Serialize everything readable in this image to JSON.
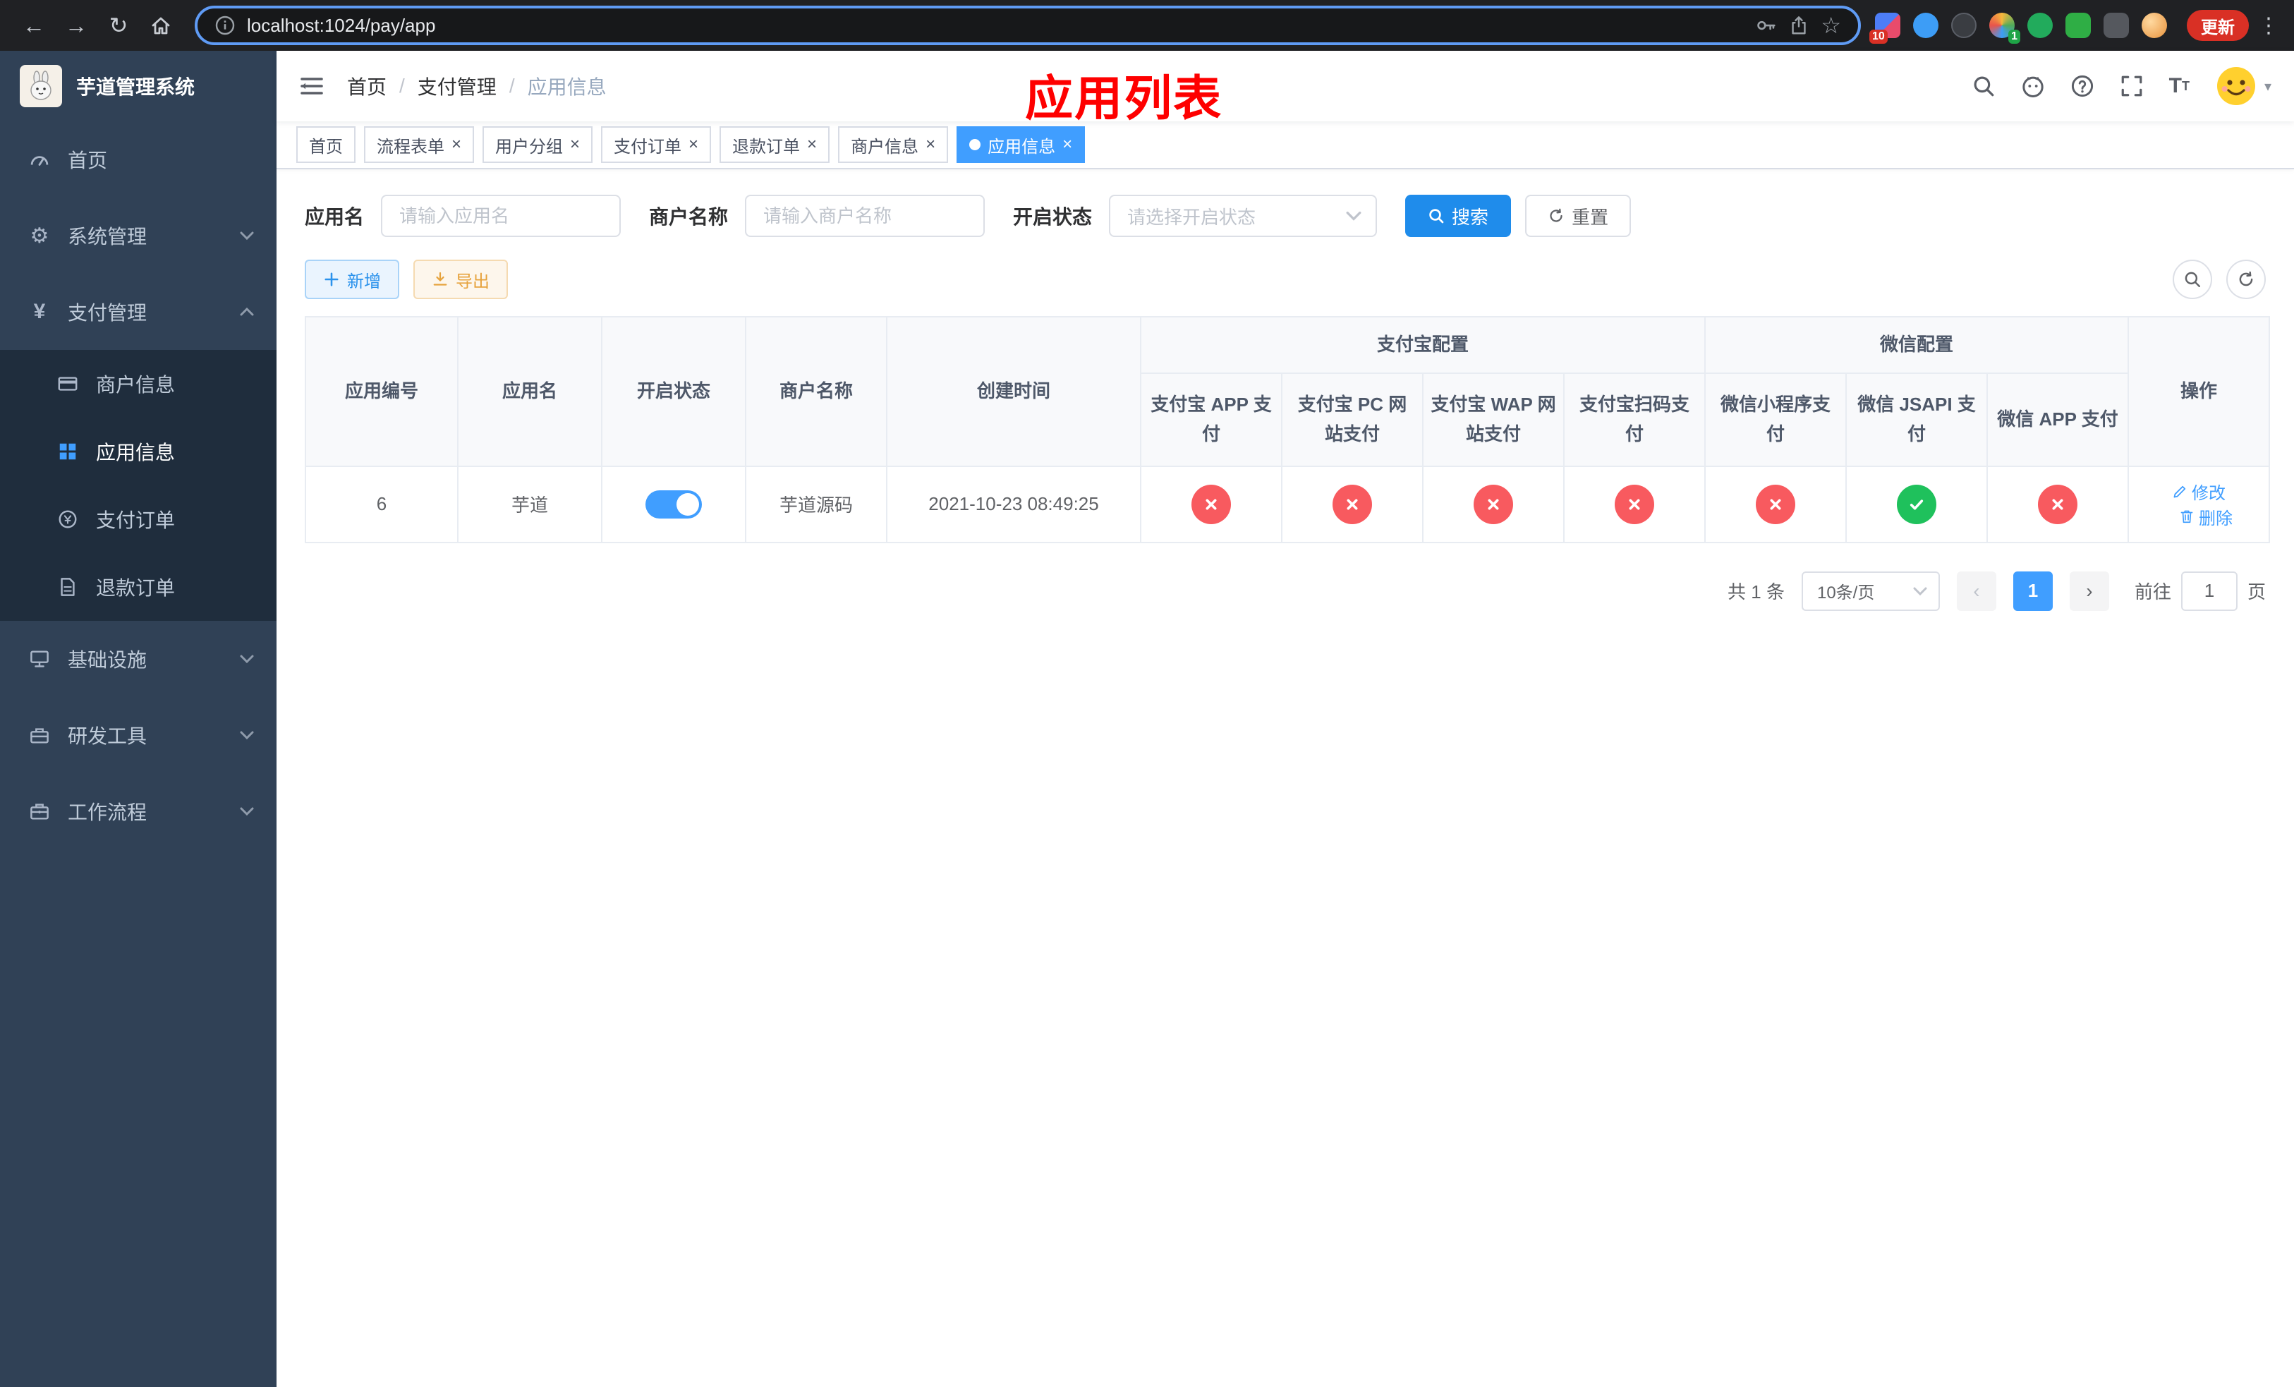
{
  "colors": {
    "primary": "#409eff",
    "success": "#1fc15c",
    "danger": "#f85a5f",
    "warning": "#e6a23c",
    "sidebar_bg": "#304156",
    "submenu_bg": "#1f2d3d",
    "annotation_red": "#fe0000"
  },
  "browser": {
    "url": "localhost:1024/pay/app",
    "update_label": "更新",
    "ext_badge_grid": "10",
    "ext_badge_translate": "1"
  },
  "sidebar": {
    "title": "芋道管理系统",
    "items": [
      {
        "label": "首页"
      },
      {
        "label": "系统管理"
      },
      {
        "label": "支付管理"
      },
      {
        "label": "基础设施"
      },
      {
        "label": "研发工具"
      },
      {
        "label": "工作流程"
      }
    ],
    "payment_sub": [
      {
        "label": "商户信息"
      },
      {
        "label": "应用信息"
      },
      {
        "label": "支付订单"
      },
      {
        "label": "退款订单"
      }
    ]
  },
  "header": {
    "breadcrumb": [
      {
        "label": "首页"
      },
      {
        "label": "支付管理"
      },
      {
        "label": "应用信息"
      }
    ],
    "annotation": "应用列表"
  },
  "tabs": [
    {
      "label": "首页"
    },
    {
      "label": "流程表单"
    },
    {
      "label": "用户分组"
    },
    {
      "label": "支付订单"
    },
    {
      "label": "退款订单"
    },
    {
      "label": "商户信息"
    },
    {
      "label": "应用信息"
    }
  ],
  "filters": {
    "app_name_label": "应用名",
    "app_name_placeholder": "请输入应用名",
    "merchant_label": "商户名称",
    "merchant_placeholder": "请输入商户名称",
    "status_label": "开启状态",
    "status_placeholder": "请选择开启状态",
    "search_label": "搜索",
    "reset_label": "重置"
  },
  "toolbar": {
    "add_label": "新增",
    "export_label": "导出"
  },
  "table": {
    "headers": {
      "app_id": "应用编号",
      "app_name": "应用名",
      "status": "开启状态",
      "merchant": "商户名称",
      "created": "创建时间",
      "alipay_group": "支付宝配置",
      "wechat_group": "微信配置",
      "channels": [
        "支付宝 APP 支付",
        "支付宝 PC 网站支付",
        "支付宝 WAP 网站支付",
        "支付宝扫码支付",
        "微信小程序支付",
        "微信 JSAPI 支付",
        "微信 APP 支付"
      ],
      "actions": "操作"
    },
    "rows": [
      {
        "app_id": "6",
        "app_name": "芋道",
        "enabled": true,
        "merchant": "芋道源码",
        "created": "2021-10-23 08:49:25",
        "channels": [
          false,
          false,
          false,
          false,
          false,
          true,
          false
        ],
        "edit_label": "修改",
        "delete_label": "删除"
      }
    ]
  },
  "pagination": {
    "total": "共 1 条",
    "page_size": "10条/页",
    "page": "1",
    "goto_label": "前往",
    "goto_value": "1",
    "unit_label": "页"
  }
}
